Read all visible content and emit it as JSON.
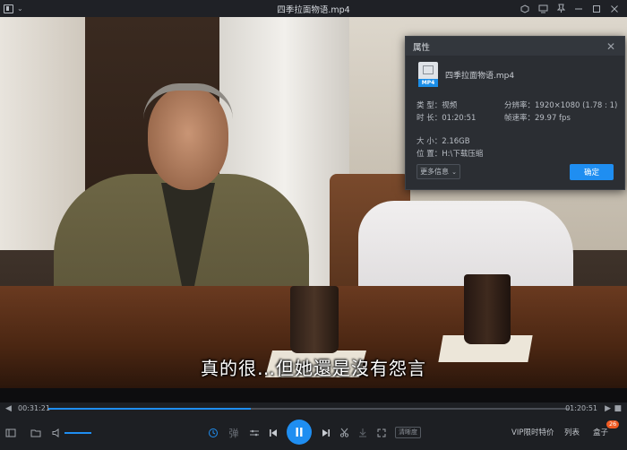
{
  "titlebar": {
    "title": "四季拉面物语.mp4"
  },
  "subtitle": "真的很…但她還是沒有怨言",
  "dialog": {
    "title": "属性",
    "file_name": "四季拉面物语.mp4",
    "file_badge": "MP4",
    "type_label": "类  型：",
    "type_value": "视频",
    "duration_label": "时  长：",
    "duration_value": "01:20:51",
    "resolution_label": "分辨率：",
    "resolution_value": "1920×1080 (1.78 : 1)",
    "framerate_label": "帧速率：",
    "framerate_value": "29.97 fps",
    "size_label": "大  小：",
    "size_value": "2.16GB",
    "location_label": "位  置：",
    "location_value": "H:\\下载压缩",
    "more_label": "更多信息",
    "ok_label": "确定"
  },
  "player": {
    "current_time": "00:31:21",
    "total_time": "01:20:51",
    "progress": 0.388,
    "quality_label": "清晰度",
    "vip_label": "VIP限时特价",
    "list_label": "列表",
    "box_label": "盒子",
    "box_count": "26"
  },
  "colors": {
    "accent": "#1f8ef1",
    "badge": "#f05a22"
  }
}
